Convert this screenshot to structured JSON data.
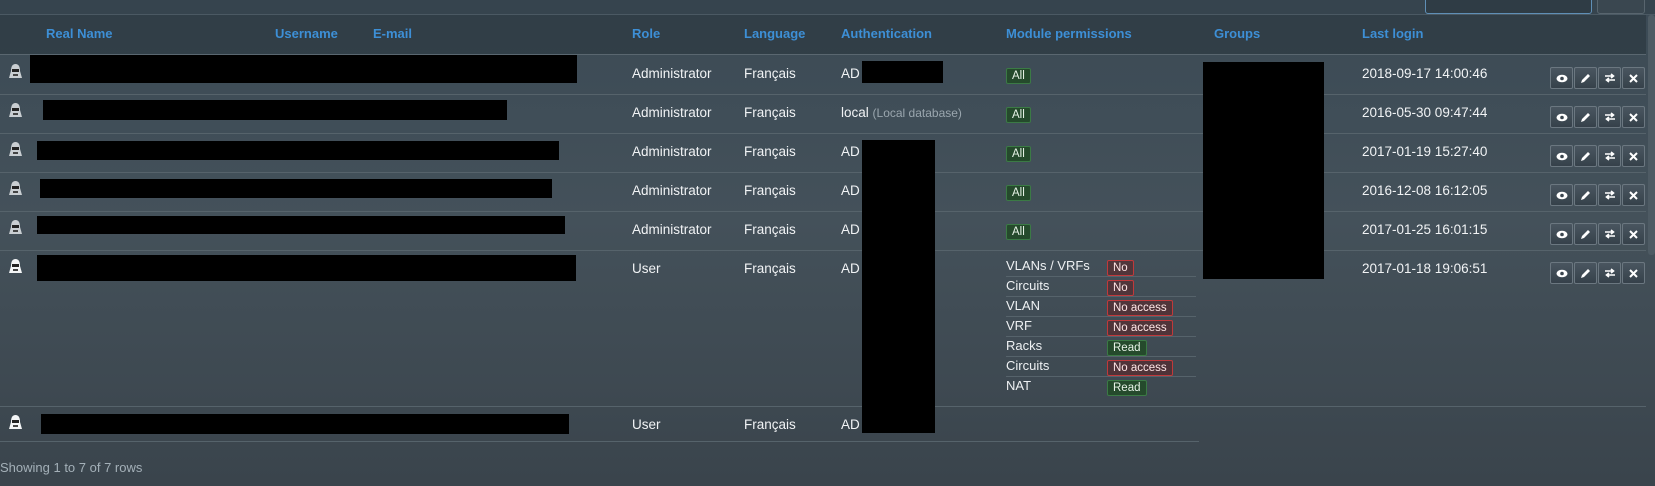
{
  "columns": {
    "real_name": "Real Name",
    "username": "Username",
    "email": "E-mail",
    "role": "Role",
    "language": "Language",
    "authentication": "Authentication",
    "module_permissions": "Module permissions",
    "groups": "Groups",
    "last_login": "Last login"
  },
  "rows": [
    {
      "role": "Administrator",
      "language": "Français",
      "auth": "AD",
      "auth_note": "",
      "perm": "All",
      "last_login": "2018-09-17 14:00:46"
    },
    {
      "role": "Administrator",
      "language": "Français",
      "auth": "local",
      "auth_note": "(Local database)",
      "perm": "All",
      "last_login": "2016-05-30 09:47:44"
    },
    {
      "role": "Administrator",
      "language": "Français",
      "auth": "AD",
      "auth_note": "",
      "perm": "All",
      "last_login": "2017-01-19 15:27:40"
    },
    {
      "role": "Administrator",
      "language": "Français",
      "auth": "AD",
      "auth_note": "",
      "perm": "All",
      "last_login": "2016-12-08 16:12:05"
    },
    {
      "role": "Administrator",
      "language": "Français",
      "auth": "AD",
      "auth_note": "",
      "perm": "All",
      "last_login": "2017-01-25 16:01:15"
    },
    {
      "role": "User",
      "language": "Français",
      "auth": "AD",
      "auth_note": "",
      "perm": "",
      "last_login": "2017-01-18 19:06:51"
    },
    {
      "role": "User",
      "language": "Français",
      "auth": "AD",
      "auth_note": "",
      "perm": "",
      "last_login": ""
    }
  ],
  "row6_permissions": [
    {
      "module": "VLANs / VRFs",
      "access": "No",
      "kind": "no"
    },
    {
      "module": "Circuits",
      "access": "No",
      "kind": "no"
    },
    {
      "module": "VLAN",
      "access": "No access",
      "kind": "no"
    },
    {
      "module": "VRF",
      "access": "No access",
      "kind": "no"
    },
    {
      "module": "Racks",
      "access": "Read",
      "kind": "read"
    },
    {
      "module": "Circuits",
      "access": "No access",
      "kind": "no"
    },
    {
      "module": "NAT",
      "access": "Read",
      "kind": "read"
    }
  ],
  "action_icons": [
    "eye-icon",
    "pencil-icon",
    "switch-icon",
    "close-icon"
  ],
  "footer": {
    "text": "Showing 1 to 7 of 7 rows"
  },
  "colors": {
    "accent": "#3d8fd6",
    "ok": "#3b7a45",
    "danger": "#c0393b"
  }
}
